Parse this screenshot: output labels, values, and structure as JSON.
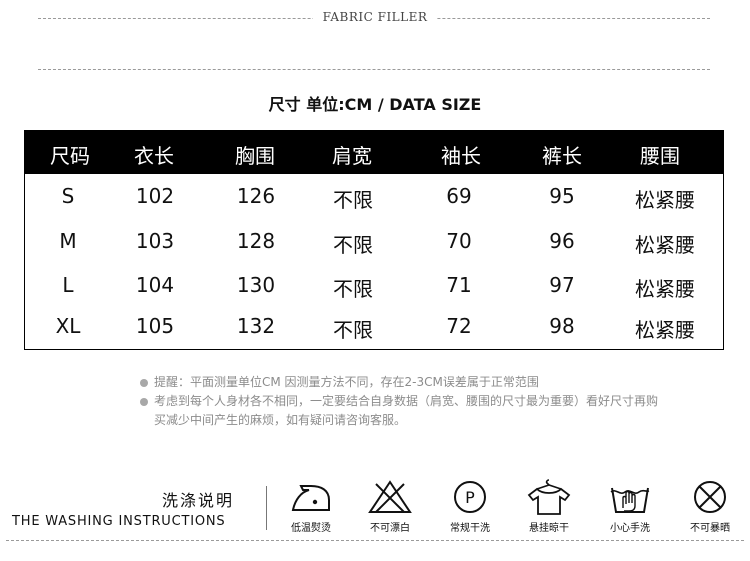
{
  "header": {
    "title": "FABRIC FILLER"
  },
  "size_chart": {
    "title": "尺寸 单位:CM / DATA SIZE",
    "columns": [
      "尺码",
      "衣长",
      "胸围",
      "肩宽",
      "袖长",
      "裤长",
      "腰围"
    ],
    "rows": [
      [
        "S",
        "102",
        "126",
        "不限",
        "69",
        "95",
        "松紧腰"
      ],
      [
        "M",
        "103",
        "128",
        "不限",
        "70",
        "96",
        "松紧腰"
      ],
      [
        "L",
        "104",
        "130",
        "不限",
        "71",
        "97",
        "松紧腰"
      ],
      [
        "XL",
        "105",
        "132",
        "不限",
        "72",
        "98",
        "松紧腰"
      ]
    ]
  },
  "notes": [
    "提醒：平面测量单位CM 因测量方法不同，存在2-3CM误差属于正常范围",
    "考虑到每个人身材各不相同，一定要结合自身数据（肩宽、腰围的尺寸最为重要）看好尺寸再购买减少中间产生的麻烦，如有疑问请咨询客服。"
  ],
  "washing": {
    "title_cn": "洗涤说明",
    "title_en": "THE WASHING INSTRUCTIONS",
    "items": [
      {
        "icon": "low-temperature-iron-icon",
        "label": "低温熨烫"
      },
      {
        "icon": "do-not-bleach-icon",
        "label": "不可漂白"
      },
      {
        "icon": "dry-clean-p-icon",
        "label": "常规干洗"
      },
      {
        "icon": "hang-dry-icon",
        "label": "悬挂晾干"
      },
      {
        "icon": "hand-wash-icon",
        "label": "小心手洗"
      },
      {
        "icon": "do-not-tumble-dry-icon",
        "label": "不可暴晒"
      }
    ]
  }
}
